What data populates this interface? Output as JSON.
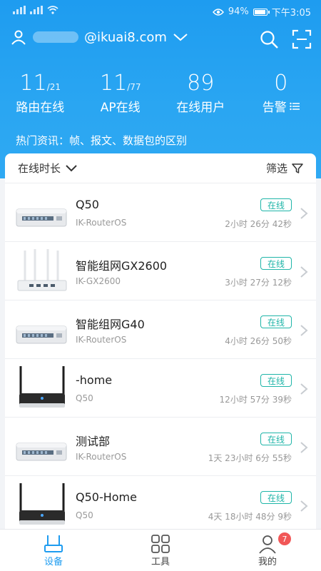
{
  "statusbar": {
    "battery": "94%",
    "battery_level": 0.94,
    "time": "下午3:05"
  },
  "header": {
    "account": "@ikuai8.com"
  },
  "stats": [
    {
      "num": "11",
      "sub": "/21",
      "label": "路由在线"
    },
    {
      "num": "11",
      "sub": "/77",
      "label": "AP在线"
    },
    {
      "num": "89",
      "sub": "",
      "label": "在线用户"
    },
    {
      "num": "0",
      "sub": "",
      "label": "告警"
    }
  ],
  "news": {
    "text": "热门资讯：帧、报文、数据包的区别"
  },
  "list_header": {
    "sort_label": "在线时长",
    "filter_label": "筛选"
  },
  "devices": [
    {
      "name": "Q50",
      "model": "IK-RouterOS",
      "status": "在线",
      "uptime": "2小时 26分 42秒",
      "thumb": "silver-box"
    },
    {
      "name": "智能组网GX2600",
      "model": "IK-GX2600",
      "status": "在线",
      "uptime": "3小时 27分 12秒",
      "thumb": "white-antenna-router"
    },
    {
      "name": "智能组网G40",
      "model": "IK-RouterOS",
      "status": "在线",
      "uptime": "4小时 26分 50秒",
      "thumb": "silver-box"
    },
    {
      "name": "-home",
      "model": "Q50",
      "status": "在线",
      "uptime": "12小时 57分 39秒",
      "thumb": "black-antenna-router"
    },
    {
      "name": "测试部",
      "model": "IK-RouterOS",
      "status": "在线",
      "uptime": "1天 23小时 6分 55秒",
      "thumb": "silver-box"
    },
    {
      "name": "Q50-Home",
      "model": "Q50",
      "status": "在线",
      "uptime": "4天 18小时 48分 9秒",
      "thumb": "black-antenna-router"
    }
  ],
  "nav": [
    {
      "label": "设备",
      "icon": "router-icon",
      "active": true
    },
    {
      "label": "工具",
      "icon": "grid-icon",
      "active": false
    },
    {
      "label": "我的",
      "icon": "person-icon",
      "active": false,
      "badge": "7"
    }
  ],
  "colors": {
    "brand": "#1e9cf0",
    "online": "#1fb5a8",
    "badge": "#f15757"
  }
}
